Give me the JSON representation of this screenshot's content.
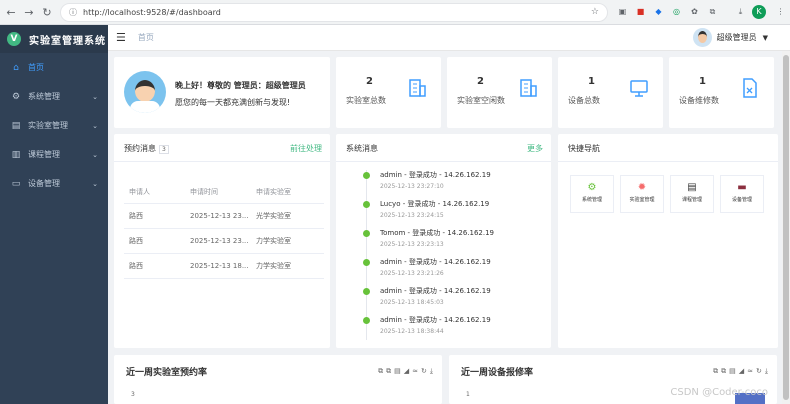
{
  "browser": {
    "url": "http://localhost:9528/#/dashboard"
  },
  "sidebar": {
    "app_title": "实验室管理系统",
    "items": [
      {
        "label": "首页",
        "icon": "home-icon"
      },
      {
        "label": "系统管理",
        "icon": "gear-icon"
      },
      {
        "label": "实验室管理",
        "icon": "lab-icon"
      },
      {
        "label": "课程管理",
        "icon": "book-icon"
      },
      {
        "label": "设备管理",
        "icon": "monitor-icon"
      }
    ]
  },
  "header": {
    "breadcrumb": "首页",
    "username": "超级管理员"
  },
  "welcome": {
    "greeting": "晚上好！尊敬的 管理员：超级管理员",
    "motto": "愿您的每一天都充满创新与发现!"
  },
  "stats": [
    {
      "value": "2",
      "label": "实验室总数",
      "icon": "building-icon"
    },
    {
      "value": "2",
      "label": "实验室空闲数",
      "icon": "building-icon"
    },
    {
      "value": "1",
      "label": "设备总数",
      "icon": "monitor-icon"
    },
    {
      "value": "1",
      "label": "设备维修数",
      "icon": "repair-doc-icon"
    }
  ],
  "booking": {
    "title": "预约消息",
    "count": "3",
    "link": "前往处理",
    "columns": [
      "申请人",
      "申请时间",
      "申请实验室"
    ],
    "rows": [
      [
        "路西",
        "2025-12-13 23...",
        "光学实验室"
      ],
      [
        "路西",
        "2025-12-13 23...",
        "力学实验室"
      ],
      [
        "路西",
        "2025-12-13 18...",
        "力学实验室"
      ]
    ]
  },
  "syslog": {
    "title": "系统消息",
    "link": "更多",
    "items": [
      {
        "text": "admin - 登录成功 - 14.26.162.19",
        "time": "2025-12-13 23:27:10"
      },
      {
        "text": "Lucyo - 登录成功 - 14.26.162.19",
        "time": "2025-12-13 23:24:15"
      },
      {
        "text": "Tomom - 登录成功 - 14.26.162.19",
        "time": "2025-12-13 23:23:13"
      },
      {
        "text": "admin - 登录成功 - 14.26.162.19",
        "time": "2025-12-13 23:21:26"
      },
      {
        "text": "admin - 登录成功 - 14.26.162.19",
        "time": "2025-12-13 18:45:03"
      },
      {
        "text": "admin - 登录成功 - 14.26.162.19",
        "time": "2025-12-13 18:38:44"
      }
    ]
  },
  "quick": {
    "title": "快捷导航",
    "items": [
      {
        "label": "系统管理",
        "icon": "gear-icon",
        "color": "#67c23a"
      },
      {
        "label": "实验室管理",
        "icon": "flask-gear-icon",
        "color": "#f56c6c"
      },
      {
        "label": "课程管理",
        "icon": "document-icon",
        "color": "#333333"
      },
      {
        "label": "设备管理",
        "icon": "monitor-icon",
        "color": "#8b2f3f"
      }
    ]
  },
  "charts": [
    {
      "title": "近一周实验室预约率",
      "y_tick": "3"
    },
    {
      "title": "近一周设备报修率",
      "y_tick": "1"
    }
  ],
  "watermark": "CSDN @Coder-coco",
  "colors": {
    "sidebar_bg": "#304156",
    "accent": "#42b983",
    "active_menu": "#409eff",
    "timeline_dot": "#67c23a",
    "stat_icon": "#409eff"
  }
}
